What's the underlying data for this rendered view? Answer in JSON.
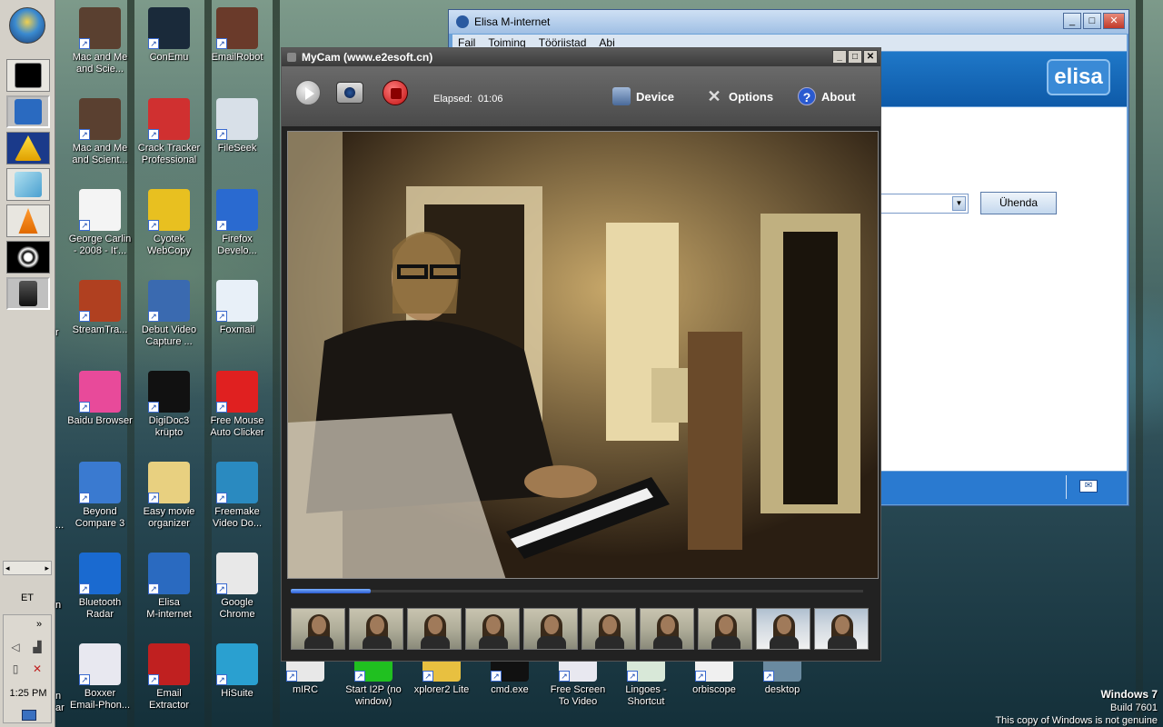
{
  "taskbar": {
    "language": "ET",
    "clock": "1:25 PM",
    "tray_expand": "»",
    "scroll_left": "◂",
    "scroll_right": "▸"
  },
  "desktop_icons": {
    "col1": [
      "Mac and Me\nand Scie...",
      "Mac and Me\nand Scient...",
      "George Carlin\n- 2008 - It'...",
      "StreamTra...",
      "Baidu Browser",
      "Beyond\nCompare 3",
      "Bluetooth\nRadar",
      "Boxxer\nEmail-Phon..."
    ],
    "col2": [
      "ConEmu",
      "Crack Tracker\nProfessional",
      "Cyotek\nWebCopy",
      "Debut Video\nCapture ...",
      "DigiDoc3\nkrüpto",
      "Easy movie\norganizer",
      "Elisa\nM-internet",
      "Email\nExtractor"
    ],
    "col3": [
      "EmailRobot",
      "FileSeek",
      "Firefox\nDevelo...",
      "Foxmail",
      "Free Mouse\nAuto Clicker",
      "Freemake\nVideo Do...",
      "Google\nChrome",
      "HiSuite"
    ],
    "bottom_row": [
      "mIRC",
      "Start I2P (no\nwindow)",
      "xplorer2 Lite",
      "cmd.exe",
      "Free Screen\nTo Video",
      "Lingoes -\nShortcut",
      "orbiscope",
      "desktop"
    ],
    "partial_edge": [
      "n",
      "r",
      "...",
      "n",
      "n",
      "ar"
    ]
  },
  "elisa_window": {
    "title": "Elisa M-internet",
    "menu": [
      "Fail",
      "Toiming",
      "Tööriistad",
      "Abi"
    ],
    "logo": "elisa",
    "connect_button": "Ühenda",
    "controls": {
      "minimize": "_",
      "maximize": "□",
      "close": "✕"
    }
  },
  "mycam_window": {
    "title": "MyCam (www.e2esoft.cn)",
    "elapsed_label": "Elapsed:",
    "elapsed_value": "01:06",
    "toolbar": {
      "device": "Device",
      "options": "Options",
      "about": "About"
    },
    "controls": {
      "minimize": "_",
      "maximize": "□",
      "close": "✕"
    },
    "progress": 0.14,
    "thumbnail_count": 10
  },
  "watermark": {
    "line1": "Windows 7",
    "line2": "Build 7601",
    "line3": "This copy of Windows is not genuine"
  },
  "colors": {
    "mycam_toolbar": "#5a5a5a",
    "elisa_blue": "#1f78c8",
    "record_red": "#c01010"
  }
}
